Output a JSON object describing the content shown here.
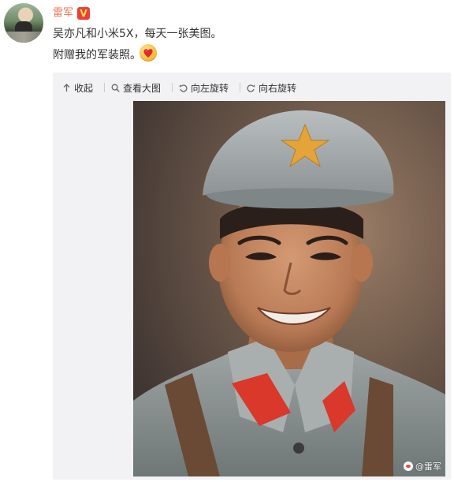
{
  "post": {
    "username": "雷军",
    "verified_badge": "V",
    "line1": "吴亦凡和小米5X，每天一张美图。",
    "line2": "附赠我的军装照。",
    "emoji": "heart-face-emoji"
  },
  "toolbar": {
    "collapse": "收起",
    "view_large": "查看大图",
    "rotate_left": "向左旋转",
    "rotate_right": "向右旋转"
  },
  "photo": {
    "watermark": "@雷军"
  },
  "colors": {
    "username": "#eb7350",
    "badge": "#e8413a",
    "text": "#333333",
    "media_bg": "#f2f2f5"
  }
}
